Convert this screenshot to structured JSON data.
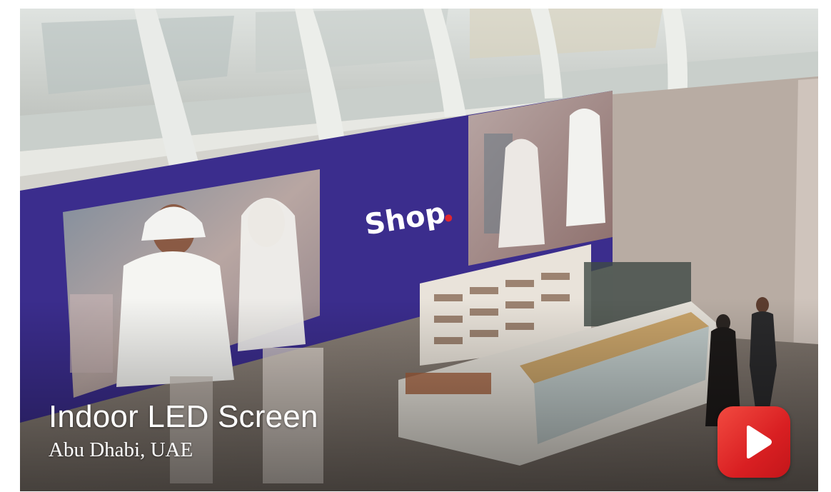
{
  "caption": {
    "title": "Indoor LED Screen",
    "location": "Abu Dhabi, UAE"
  },
  "screen": {
    "logo_text": "Shop",
    "logo_dot_color": "#e0262f",
    "panel_color": "#3d2f8f"
  },
  "play_button": {
    "icon": "play-icon",
    "color": "#e2282a"
  }
}
